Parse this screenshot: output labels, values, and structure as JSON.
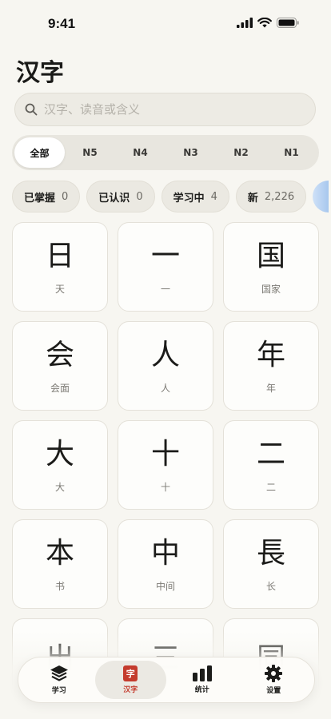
{
  "status": {
    "time": "9:41"
  },
  "header": {
    "title": "汉字"
  },
  "search": {
    "placeholder": "汉字、读音或含义"
  },
  "levels": [
    {
      "label": "全部",
      "active": true
    },
    {
      "label": "N5"
    },
    {
      "label": "N4"
    },
    {
      "label": "N3"
    },
    {
      "label": "N2"
    },
    {
      "label": "N1"
    }
  ],
  "filters": [
    {
      "label": "已掌握",
      "count": "0"
    },
    {
      "label": "已认识",
      "count": "0"
    },
    {
      "label": "学习中",
      "count": "4"
    },
    {
      "label": "新",
      "count": "2,226"
    }
  ],
  "kanji": [
    {
      "char": "日",
      "meaning": "天"
    },
    {
      "char": "一",
      "meaning": "一"
    },
    {
      "char": "国",
      "meaning": "国家"
    },
    {
      "char": "会",
      "meaning": "会面"
    },
    {
      "char": "人",
      "meaning": "人"
    },
    {
      "char": "年",
      "meaning": "年"
    },
    {
      "char": "大",
      "meaning": "大"
    },
    {
      "char": "十",
      "meaning": "十"
    },
    {
      "char": "二",
      "meaning": "二"
    },
    {
      "char": "本",
      "meaning": "书"
    },
    {
      "char": "中",
      "meaning": "中间"
    },
    {
      "char": "長",
      "meaning": "长"
    },
    {
      "char": "出",
      "meaning": ""
    },
    {
      "char": "三",
      "meaning": ""
    },
    {
      "char": "同",
      "meaning": ""
    }
  ],
  "tabbar": {
    "items": [
      {
        "label": "学习",
        "icon": "layers-icon"
      },
      {
        "label": "汉字",
        "icon": "zi-icon",
        "active": true,
        "glyph": "字"
      },
      {
        "label": "统计",
        "icon": "bar-chart-icon"
      },
      {
        "label": "设置",
        "icon": "gear-icon"
      }
    ]
  },
  "colors": {
    "accent": "#c43b2d",
    "background": "#f7f6f1"
  }
}
